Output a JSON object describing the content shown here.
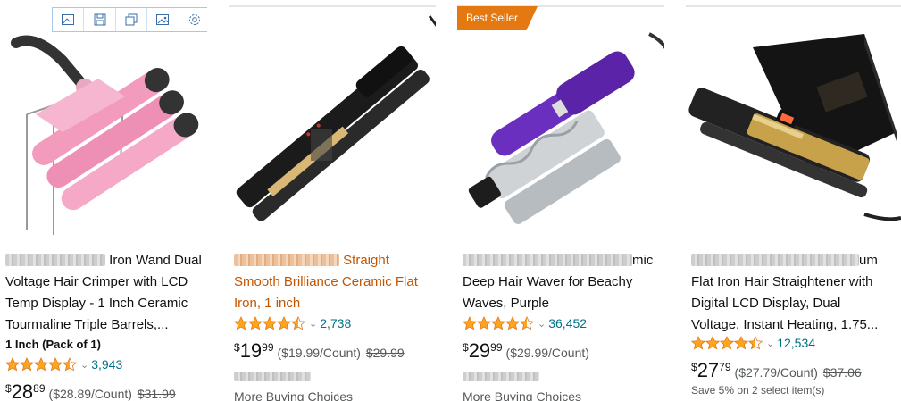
{
  "toolbar": {
    "icons": [
      "image-edit-icon",
      "save-icon",
      "copy-icon",
      "image-icon",
      "settings-icon"
    ]
  },
  "products": [
    {
      "badge": "",
      "title_line1_visible": "Iron Wand Dual",
      "title_line2": "Voltage Hair Crimper with LCD",
      "title_line3": "Temp Display - 1 Inch Ceramic",
      "title_line4": "Tourmaline Triple Barrels,...",
      "size": "1 Inch (Pack of 1)",
      "rating_stars": 4.5,
      "rating_count": "3,943",
      "price_symbol": "$",
      "price_whole": "28",
      "price_fraction": "89",
      "unit_price": "($28.89/Count)",
      "list_price": "$31.99",
      "more_buying": ""
    },
    {
      "badge": "",
      "title_line1_visible": "Straight",
      "title_line2": "Smooth Brilliance Ceramic Flat",
      "title_line3": "Iron, 1 inch",
      "rating_stars": 4.5,
      "rating_count": "2,738",
      "price_symbol": "$",
      "price_whole": "19",
      "price_fraction": "99",
      "unit_price": "($19.99/Count)",
      "list_price": "$29.99",
      "more_buying": "More Buying Choices"
    },
    {
      "badge": "Best Seller",
      "title_line1_visible": "mic",
      "title_line2": "Deep Hair Waver for Beachy",
      "title_line3": "Waves, Purple",
      "rating_stars": 4.5,
      "rating_count": "36,452",
      "price_symbol": "$",
      "price_whole": "29",
      "price_fraction": "99",
      "unit_price": "($29.99/Count)",
      "list_price": "",
      "more_buying": "More Buying Choices"
    },
    {
      "badge": "",
      "title_line1_visible": "um",
      "title_line2": "Flat Iron Hair Straightener with",
      "title_line3": "Digital LCD Display, Dual",
      "title_line4": "Voltage, Instant Heating, 1.75...",
      "rating_stars": 4.5,
      "rating_count": "12,534",
      "price_symbol": "$",
      "price_whole": "27",
      "price_fraction": "79",
      "unit_price": "($27.79/Count)",
      "list_price": "$37.06",
      "save_text": "Save 5% on 2 select item(s)"
    }
  ],
  "colors": {
    "star": "#ffa41c",
    "link": "#007185",
    "badge": "#e47911",
    "sponsored_title": "#c45500"
  }
}
